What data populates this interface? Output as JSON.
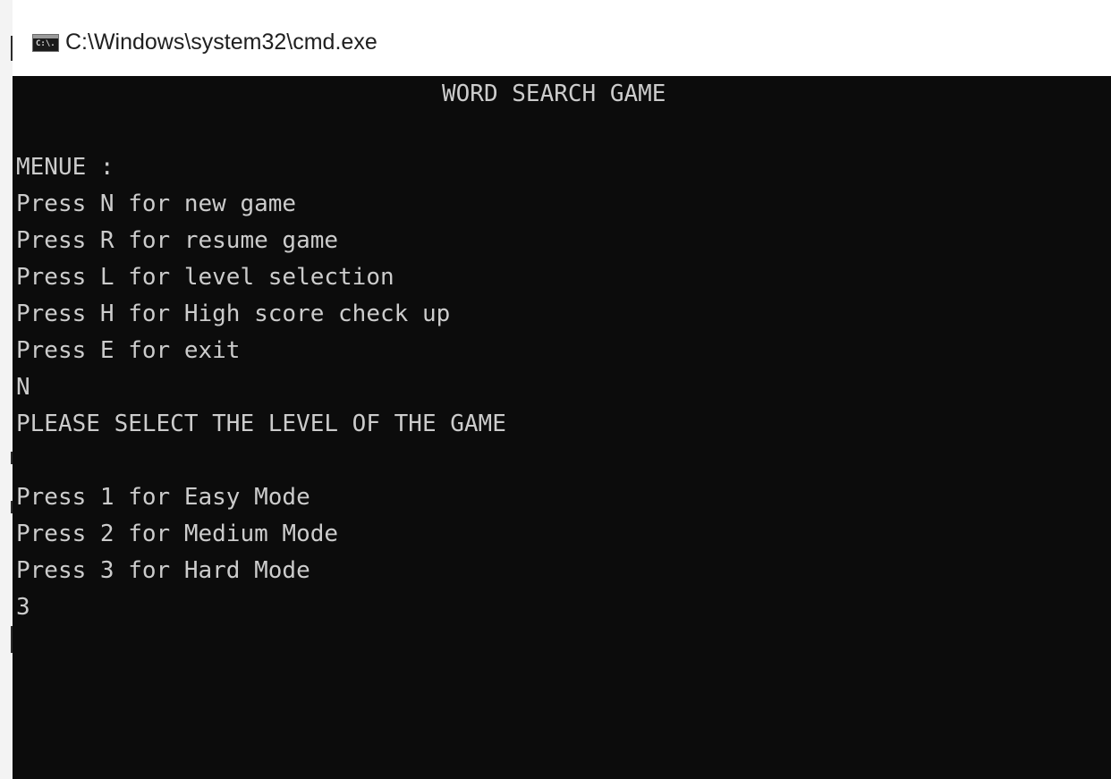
{
  "window": {
    "title": "C:\\Windows\\system32\\cmd.exe",
    "icon": "cmd-icon",
    "icon_glyph": "C:\\."
  },
  "console": {
    "background_color": "#0c0c0c",
    "text_color": "#cccccc",
    "title": "WORD SEARCH GAME",
    "lines": [
      "",
      "MENUE :",
      "Press N for new game",
      "Press R for resume game",
      "Press L for level selection",
      "Press H for High score check up",
      "Press E for exit",
      "N",
      "PLEASE SELECT THE LEVEL OF THE GAME",
      "",
      "Press 1 for Easy Mode",
      "Press 2 for Medium Mode",
      "Press 3 for Hard Mode",
      "3"
    ]
  }
}
